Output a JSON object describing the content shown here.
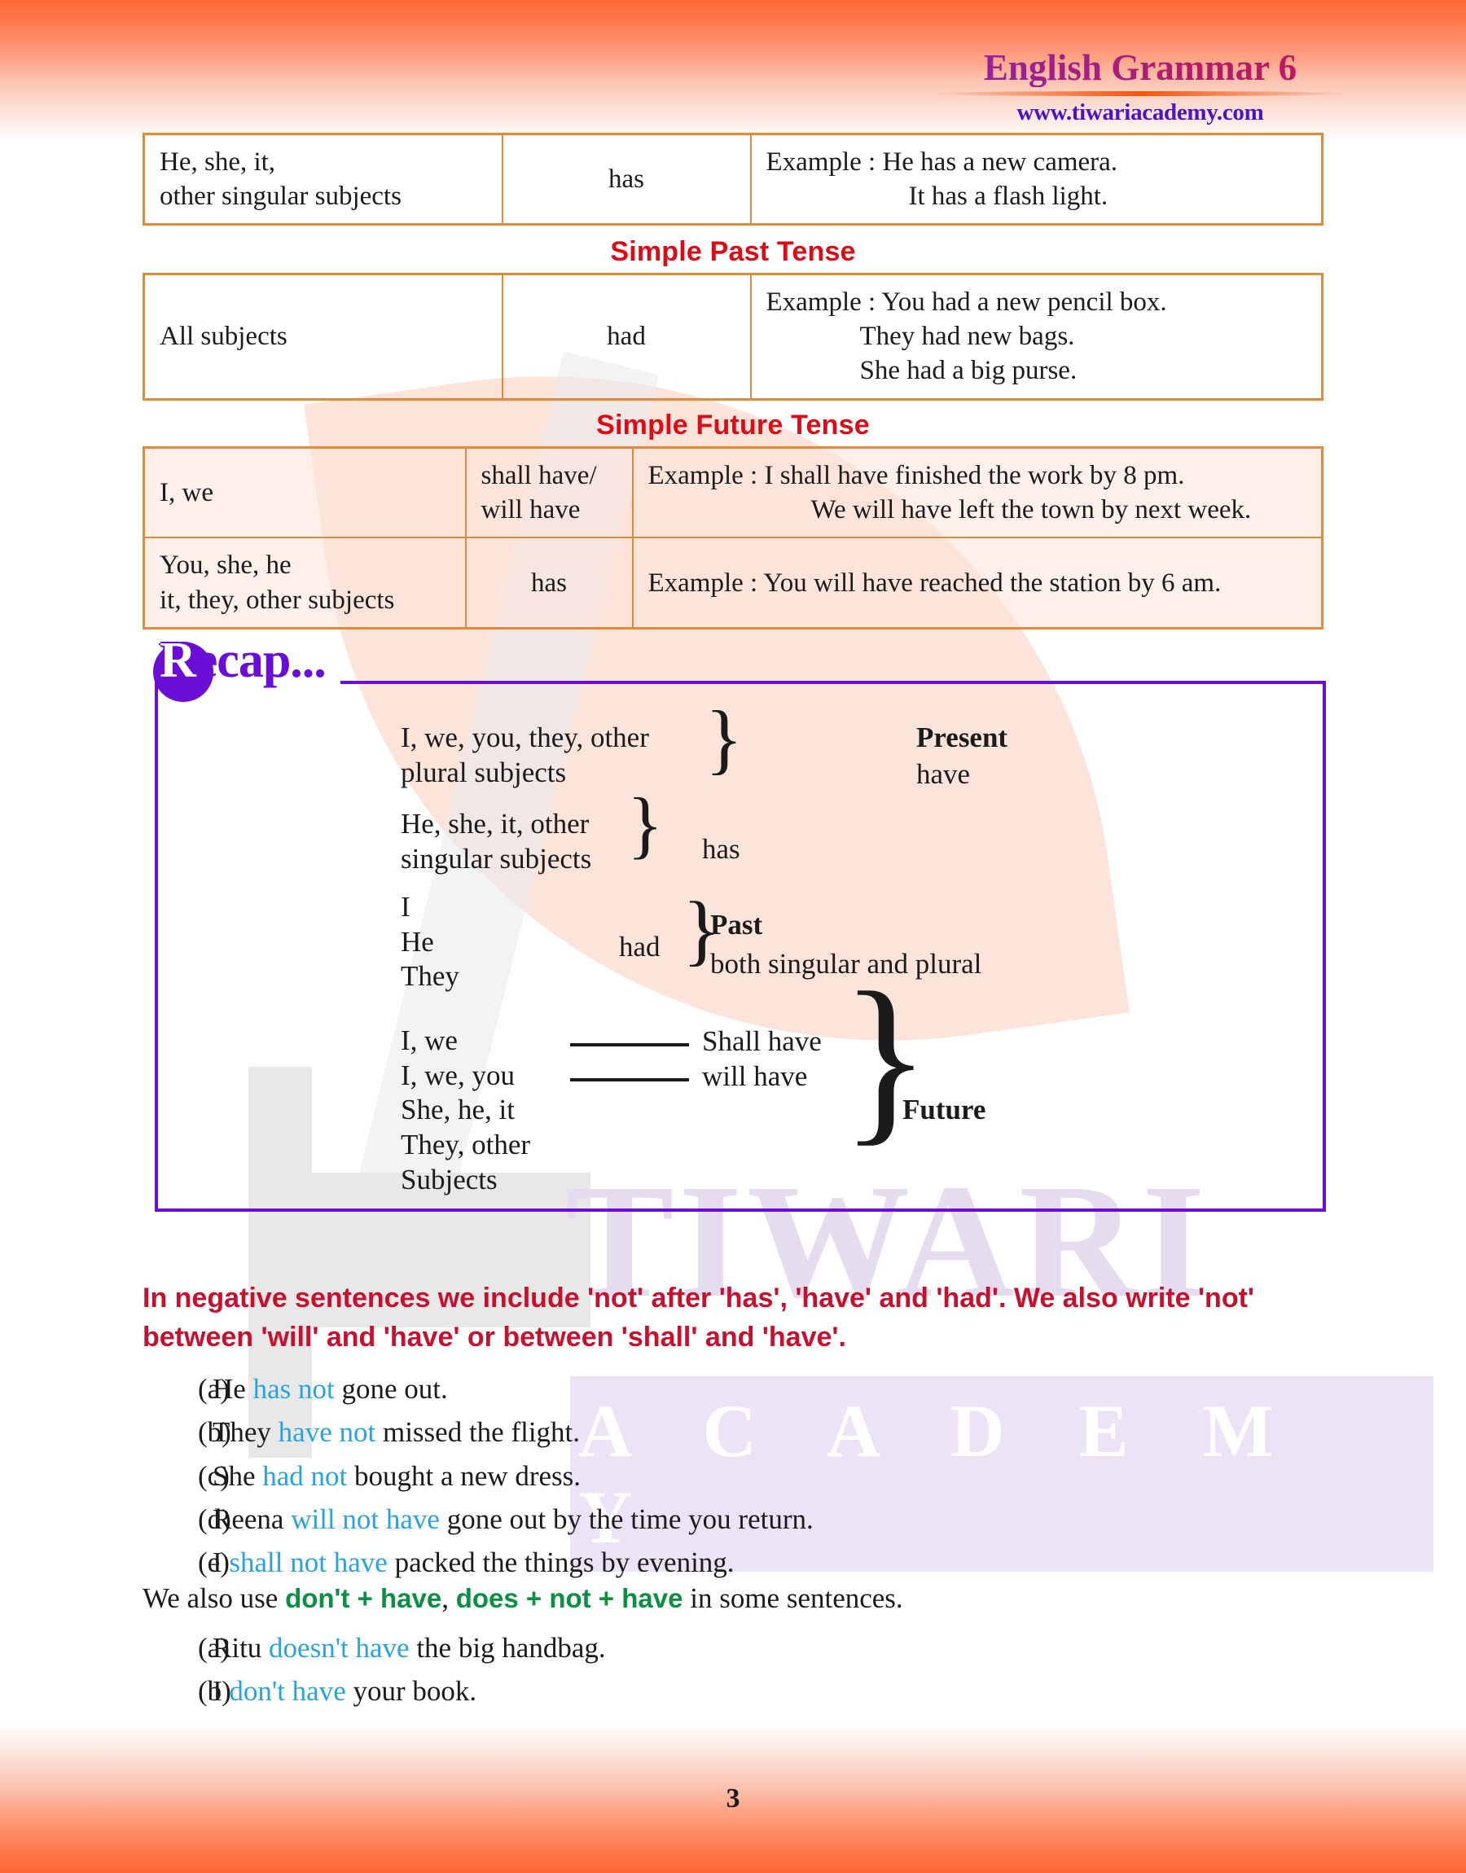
{
  "header": {
    "title": "English Grammar 6",
    "url": "www.tiwariacademy.com"
  },
  "watermark": {
    "line1": "TIWARI",
    "line2": "A C A D E M Y"
  },
  "tables": [
    {
      "id": "present-perfect-singular",
      "rows": [
        {
          "subject_line1": "He, she, it,",
          "subject_line2": "other singular subjects",
          "verb": "has",
          "examples": [
            "Example : He has a new camera.",
            "It has a flash light."
          ]
        }
      ]
    },
    {
      "id": "simple-past",
      "heading": "Simple Past Tense",
      "rows": [
        {
          "subject_line1": "All subjects",
          "subject_line2": "",
          "verb": "had",
          "examples": [
            "Example : You had a new pencil box.",
            "They had new bags.",
            "She had a big purse."
          ]
        }
      ]
    },
    {
      "id": "simple-future",
      "heading": "Simple Future Tense",
      "rows": [
        {
          "subject_line1": "I, we",
          "subject_line2": "",
          "verb_line1": "shall have/",
          "verb_line2": "will have",
          "examples": [
            "Example : I shall have finished the work by 8 pm.",
            "We will have left the town by next week."
          ]
        },
        {
          "subject_line1": "You, she, he",
          "subject_line2": "it, they, other subjects",
          "verb_line1": "has",
          "verb_line2": "",
          "examples": [
            "Example : You will have reached the station by 6 am."
          ]
        }
      ]
    }
  ],
  "recap": {
    "label": "Recap...",
    "label_initial": "R",
    "label_rest": "ecap...",
    "groups": [
      {
        "subjects": [
          "I, we, you, they, other",
          "plural subjects"
        ],
        "verb": "",
        "tense": "Present",
        "tense_note": "have"
      },
      {
        "subjects": [
          "He, she, it, other",
          "singular subjects"
        ],
        "verb": "has",
        "tense": "",
        "tense_note": ""
      },
      {
        "subjects": [
          "I",
          "He",
          "They"
        ],
        "verb": "had",
        "tense": "Past",
        "tense_note": "both singular and plural"
      },
      {
        "subjects": [
          "I, we",
          "I, we, you",
          "She, he, it",
          "They, other",
          "Subjects"
        ],
        "verb_options": [
          "Shall have",
          "will have"
        ],
        "tense": "Future",
        "tense_note": ""
      }
    ]
  },
  "negative_rule": "In negative sentences we include 'not' after 'has', 'have' and 'had'. We also write 'not' between 'will' and 'have' or between 'shall' and 'have'.",
  "negative_examples": [
    {
      "label": "(a)",
      "pre": "He ",
      "hl": "has not",
      "post": " gone out."
    },
    {
      "label": "(b)",
      "pre": "They ",
      "hl": "have not",
      "post": " missed the flight."
    },
    {
      "label": "(c)",
      "pre": "She ",
      "hl": "had not",
      "post": " bought a new dress."
    },
    {
      "label": "(d)",
      "pre": "Reena ",
      "hl": "will not have",
      "post": " gone out by the time you return."
    },
    {
      "label": "(e)",
      "pre": "I ",
      "hl": "shall not have",
      "post": " packed the things by evening."
    }
  ],
  "also_use": {
    "pre": "We also use ",
    "term1": "don't + have",
    "mid": ", ",
    "term2": "does + not + have",
    "post": " in some sentences."
  },
  "dont_examples": [
    {
      "label": "(a)",
      "pre": "Ritu ",
      "hl": "doesn't have",
      "post": " the big handbag."
    },
    {
      "label": "(b)",
      "pre": "I ",
      "hl": "don't have",
      "post": " your book."
    }
  ],
  "page_number": "3",
  "colors": {
    "table_border": "#E08A3C",
    "tense_heading": "#DD0B16",
    "recap_purple": "#6A0DD6",
    "negative_red": "#C8102E",
    "highlight_blue": "#29A3E0",
    "highlight_green": "#0A8F43",
    "header_magenta": "#A42A8C",
    "header_url_blue": "#4B12C8",
    "page_gradient": "#FF6634"
  }
}
